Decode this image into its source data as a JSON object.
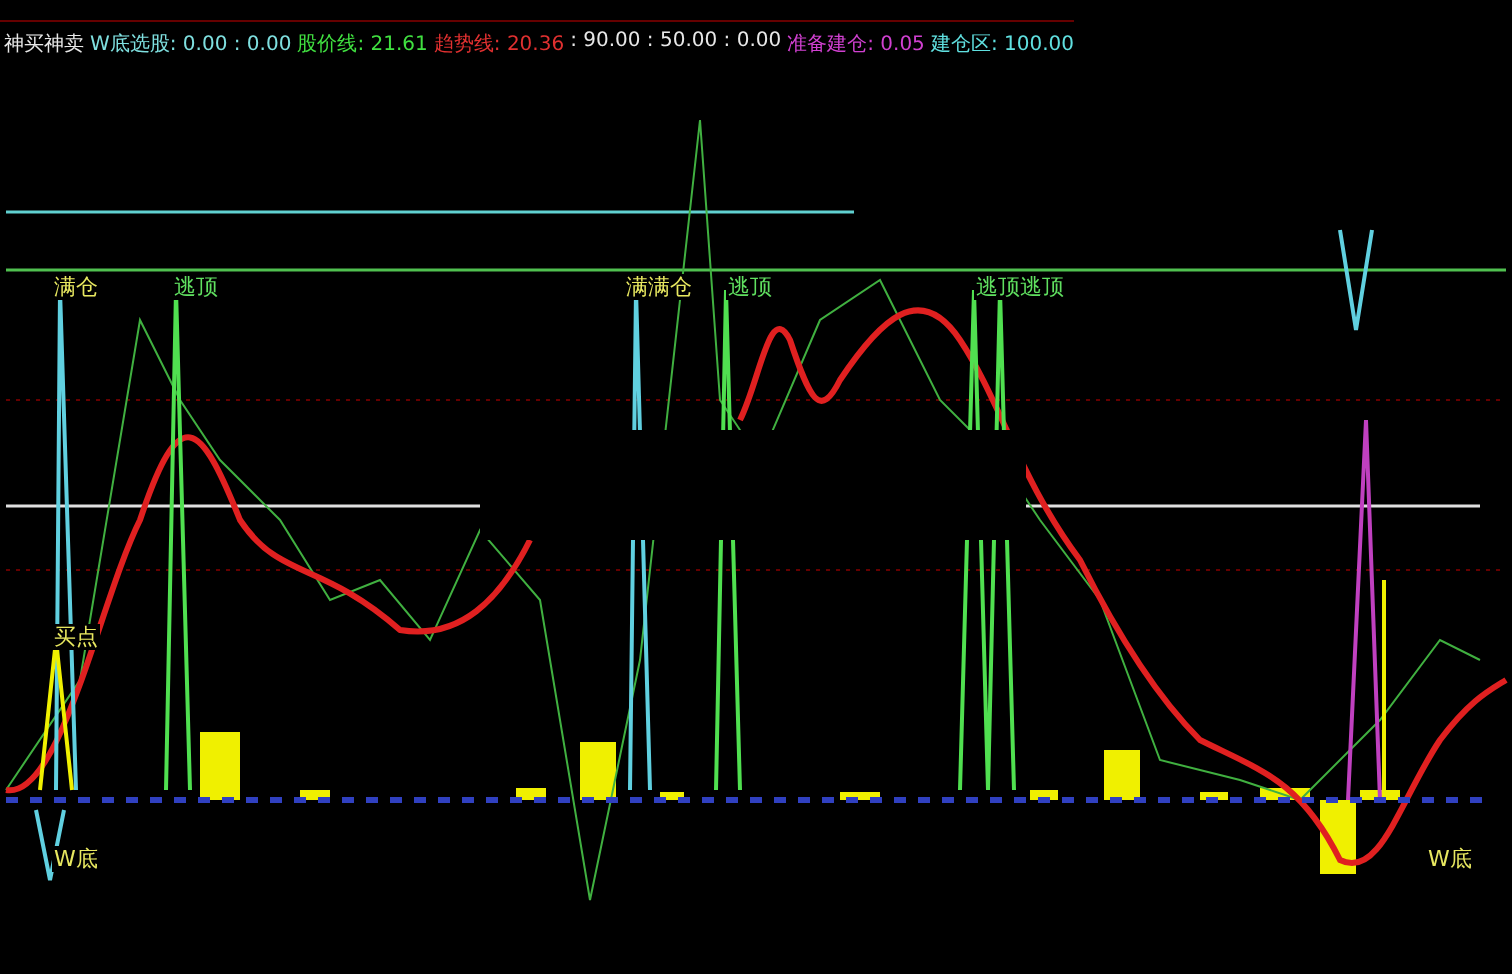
{
  "header": {
    "items": [
      {
        "text": "神买神卖",
        "color": "#e8e8e8"
      },
      {
        "text": "W底选股: 0.00 : 0.00",
        "color": "#7fe0e0"
      },
      {
        "text": "股价线: 21.61",
        "color": "#40e040"
      },
      {
        "text": "趋势线: 20.36",
        "color": "#e03030"
      },
      {
        "text": ": 90.00 : 50.00 : 0.00",
        "color": "#e8e8e8"
      },
      {
        "text": "准备建仓: 0.05",
        "color": "#d040d0"
      },
      {
        "text": "建仓区: 100.00",
        "color": "#60e0e0"
      }
    ]
  },
  "chart": {
    "labels": [
      {
        "text": "满仓",
        "kind": "full"
      },
      {
        "text": "逃顶",
        "kind": "top"
      },
      {
        "text": "满满仓",
        "kind": "full"
      },
      {
        "text": "逃顶",
        "kind": "top"
      },
      {
        "text": "逃顶逃顶",
        "kind": "top"
      },
      {
        "text": "买点",
        "kind": "buy"
      },
      {
        "text": "W底",
        "kind": "bottom"
      },
      {
        "text": "W底",
        "kind": "bottom"
      }
    ]
  }
}
